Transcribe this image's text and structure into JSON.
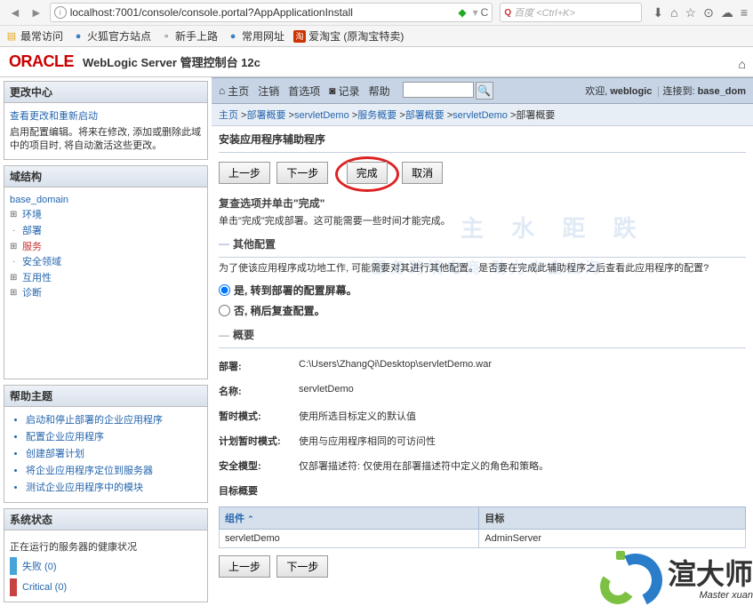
{
  "browser": {
    "url": "localhost:7001/console/console.portal?AppApplicationInstall",
    "search_placeholder": "百度 <Ctrl+K>",
    "bookmarks": [
      "最常访问",
      "火狐官方站点",
      "新手上路",
      "常用网址",
      "爱淘宝 (原淘宝特卖)"
    ]
  },
  "header": {
    "logo": "ORACLE",
    "title": "WebLogic Server 管理控制台 12c"
  },
  "toolbar": {
    "items": [
      "主页",
      "注销",
      "首选项",
      "记录",
      "帮助"
    ],
    "welcome_prefix": "欢迎, ",
    "welcome_user": "weblogic",
    "connected_prefix": "连接到: ",
    "connected_to": "base_dom"
  },
  "breadcrumb": [
    "主页",
    "部署概要",
    "servletDemo",
    "服务概要",
    "部署概要",
    "servletDemo",
    "部署概要"
  ],
  "left": {
    "change_center": {
      "title": "更改中心",
      "link": "查看更改和重新启动",
      "text": "启用配置编辑。将来在修改, 添加或删除此域中的项目时, 将自动激活这些更改。"
    },
    "domain": {
      "title": "域结构",
      "root": "base_domain",
      "items": [
        "环境",
        "部署",
        "服务",
        "安全领域",
        "互用性",
        "诊断"
      ]
    },
    "help": {
      "title": "帮助主题",
      "items": [
        "启动和停止部署的企业应用程序",
        "配置企业应用程序",
        "创建部署计划",
        "将企业应用程序定位到服务器",
        "测试企业应用程序中的模块"
      ]
    },
    "status": {
      "title": "系统状态",
      "text": "正在运行的服务器的健康状况",
      "fail_label": "失败 (0)",
      "critical_label": "Critical (0)"
    }
  },
  "main": {
    "title": "安装应用程序辅助程序",
    "buttons": {
      "back": "上一步",
      "next": "下一步",
      "finish": "完成",
      "cancel": "取消"
    },
    "section1": {
      "title": "复查选项并单击\"完成\"",
      "desc": "单击\"完成\"完成部署。这可能需要一些时间才能完成。"
    },
    "section2": {
      "title": "其他配置",
      "desc": "为了使该应用程序成功地工作, 可能需要对其进行其他配置。是否要在完成此辅助程序之后查看此应用程序的配置?"
    },
    "radios": {
      "opt1": "是, 转到部署的配置屏幕。",
      "opt2": "否, 稍后复查配置。"
    },
    "overview": {
      "title": "概要",
      "rows": {
        "deploy_label": "部署:",
        "deploy_value": "C:\\Users\\ZhangQi\\Desktop\\servletDemo.war",
        "name_label": "名称:",
        "name_value": "servletDemo",
        "tempmode_label": "暂时模式:",
        "tempmode_value": "使用所选目标定义的默认值",
        "planmode_label": "计划暂时模式:",
        "planmode_value": "使用与应用程序相同的可访问性",
        "security_label": "安全模型:",
        "security_value": "仅部署描述符: 仅使用在部署描述符中定义的角色和策略。",
        "target_label": "目标概要"
      }
    },
    "table": {
      "col_component": "组件",
      "col_target": "目标",
      "row_component": "servletDemo",
      "row_target": "AdminServer"
    }
  },
  "watermark": {
    "line1": "主 水 距 跌",
    "line2": "服务跨境电商 助力中企出海"
  },
  "brand": {
    "name": "渲大师",
    "sub": "Master xuan"
  }
}
